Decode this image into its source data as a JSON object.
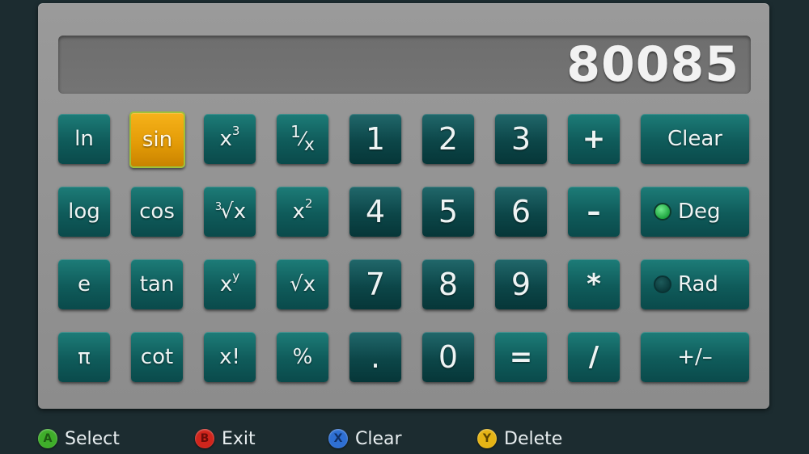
{
  "display": {
    "value": "80085"
  },
  "keys": {
    "ln": "ln",
    "sin": "sin",
    "x3_base": "x",
    "x3_exp": "3",
    "recip_num": "1",
    "recip_den": "x",
    "k1": "1",
    "k2": "2",
    "k3": "3",
    "plus": "+",
    "clear": "Clear",
    "log": "log",
    "cos": "cos",
    "cbrt_idx": "3",
    "cbrt_sym": "√x",
    "x2_base": "x",
    "x2_exp": "2",
    "k4": "4",
    "k5": "5",
    "k6": "6",
    "minus": "–",
    "deg": "Deg",
    "e": "e",
    "tan": "tan",
    "xy_base": "x",
    "xy_exp": "y",
    "sqrt": "√x",
    "k7": "7",
    "k8": "8",
    "k9": "9",
    "multiply": "*",
    "rad": "Rad",
    "pi": "π",
    "cot": "cot",
    "fact": "x!",
    "percent": "%",
    "dot": ".",
    "k0": "0",
    "equals": "=",
    "divide": "/",
    "negate": "+/–"
  },
  "selected_key": "sin",
  "angle_mode": "Deg",
  "footer": {
    "a": {
      "glyph": "A",
      "label": "Select",
      "color": "#3fae2a"
    },
    "b": {
      "glyph": "B",
      "label": "Exit",
      "color": "#d0251c"
    },
    "x": {
      "glyph": "X",
      "label": "Clear",
      "color": "#2e6fd3"
    },
    "y": {
      "glyph": "Y",
      "label": "Delete",
      "color": "#e5b415"
    }
  }
}
